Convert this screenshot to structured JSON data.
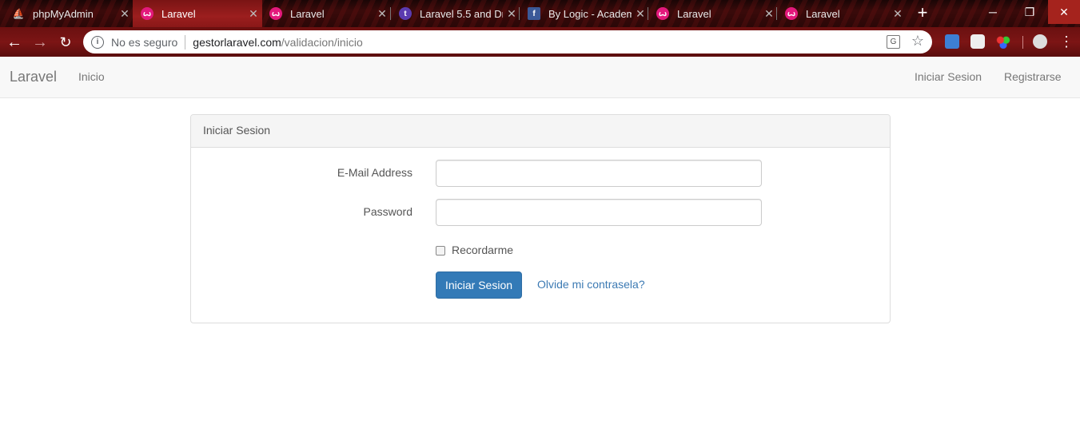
{
  "browser": {
    "tabs": [
      {
        "title": "phpMyAdmin",
        "icon": "phpmyadmin-icon",
        "active": false
      },
      {
        "title": "Laravel",
        "icon": "laravel-icon",
        "active": true
      },
      {
        "title": "Laravel",
        "icon": "laravel-icon",
        "active": false
      },
      {
        "title": "Laravel 5.5 and Dr",
        "icon": "t-logo-icon",
        "active": false
      },
      {
        "title": "By Logic - Academ",
        "icon": "facebook-icon",
        "active": false
      },
      {
        "title": "Laravel",
        "icon": "laravel-icon",
        "active": false
      },
      {
        "title": "Laravel",
        "icon": "laravel-icon",
        "active": false
      }
    ],
    "security_label": "No es seguro",
    "url_host": "gestorlaravel.com",
    "url_path": "/validacion/inicio",
    "close_glyph": "✕",
    "new_tab_glyph": "+",
    "theme_color": "#7c1515"
  },
  "navbar": {
    "brand": "Laravel",
    "home_link": "Inicio",
    "login_link": "Iniciar Sesion",
    "register_link": "Registrarse"
  },
  "login_panel": {
    "heading": "Iniciar Sesion",
    "email_label": "E-Mail Address",
    "email_value": "",
    "password_label": "Password",
    "password_value": "",
    "remember_label": "Recordarme",
    "remember_checked": false,
    "submit_label": "Iniciar Sesion",
    "forgot_link": "Olvide mi contrasela?",
    "primary_color": "#337ab7"
  }
}
